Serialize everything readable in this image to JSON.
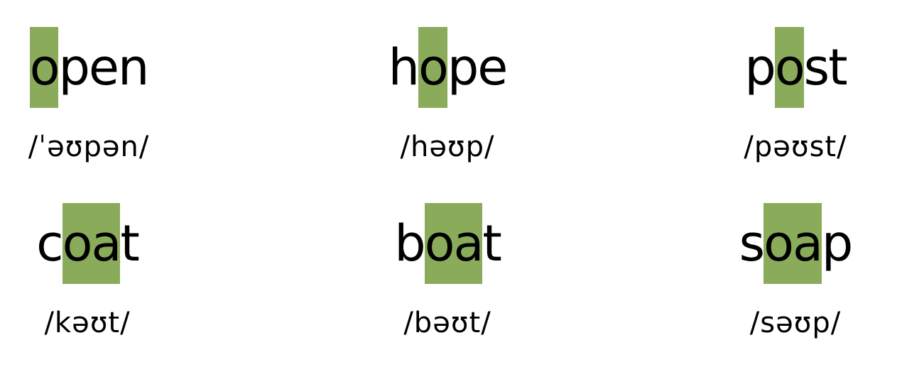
{
  "highlight_color": "#8aac5a",
  "words": [
    {
      "word": "open",
      "before": "",
      "highlight": "o",
      "after": "pen",
      "ipa": "/ˈəʊpən/"
    },
    {
      "word": "hope",
      "before": "h",
      "highlight": "o",
      "after": "pe",
      "ipa": "/həʊp/"
    },
    {
      "word": "post",
      "before": "p",
      "highlight": "o",
      "after": "st",
      "ipa": "/pəʊst/"
    },
    {
      "word": "coat",
      "before": "c",
      "highlight": "oa",
      "after": "t",
      "ipa": "/kəʊt/"
    },
    {
      "word": "boat",
      "before": "b",
      "highlight": "oa",
      "after": "t",
      "ipa": "/bəʊt/"
    },
    {
      "word": "soap",
      "before": "s",
      "highlight": "oa",
      "after": "p",
      "ipa": "/səʊp/"
    }
  ]
}
